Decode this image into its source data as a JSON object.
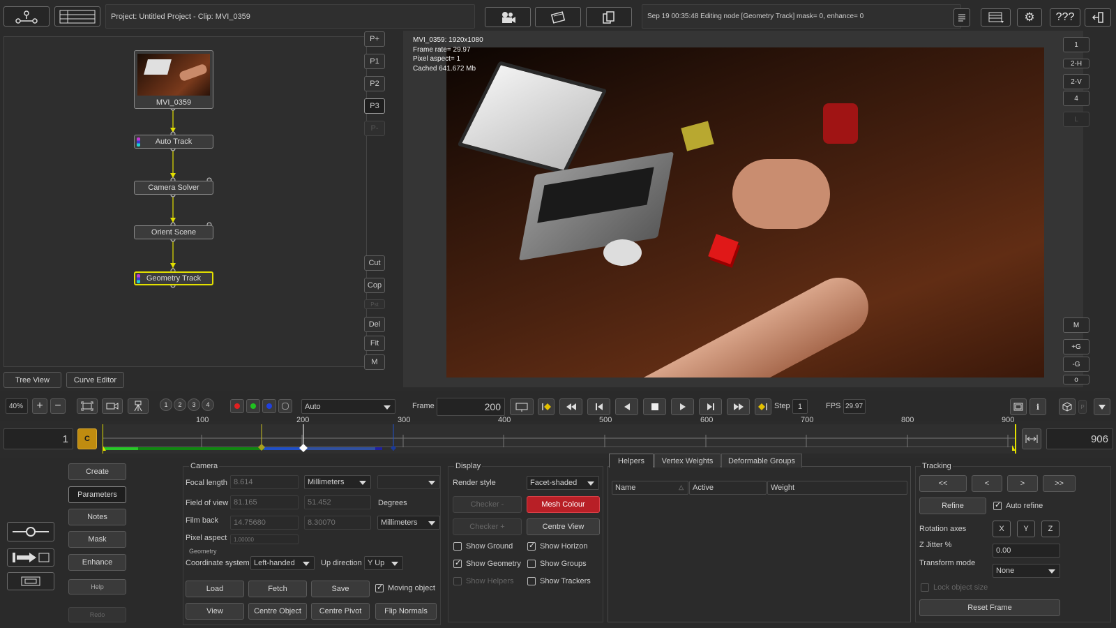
{
  "header": {
    "project_clip": "Project: Untitled Project - Clip: MVI_0359",
    "status": "Sep 19 00:35:48 Editing node [Geometry Track] mask= 0, enhance= 0",
    "help_label": "???"
  },
  "tree": {
    "nodes": {
      "source": "MVI_0359",
      "auto_track": "Auto Track",
      "camera_solver": "Camera Solver",
      "orient_scene": "Orient Scene",
      "geometry_track": "Geometry Track"
    },
    "tabs": {
      "tree_view": "Tree View",
      "curve_editor": "Curve Editor"
    }
  },
  "side_buttons": {
    "p_plus": "P+",
    "p1": "P1",
    "p2": "P2",
    "p3": "P3",
    "p_minus": "P-",
    "cut": "Cut",
    "cop": "Cop",
    "paste": "Pst",
    "del": "Del",
    "fit": "Fit",
    "m": "M"
  },
  "viewer": {
    "info_line1": "MVI_0359: 1920x1080",
    "info_line2": "Frame rate= 29.97",
    "info_line3": "Pixel aspect= 1",
    "info_line4": "Cached 641.672 Mb"
  },
  "right_buttons": {
    "b1": "1",
    "b2": "2-H",
    "b3": "2-V",
    "b4": "4",
    "b5": "L",
    "m": "M",
    "plus_g": "+G",
    "minus_g": "-G",
    "o": "o"
  },
  "transport": {
    "zoom": "40%",
    "view_nums": [
      "1",
      "2",
      "3",
      "4"
    ],
    "channel_mode": "Auto",
    "frame_label": "Frame",
    "frame_value": "200",
    "step_label": "Step",
    "step_value": "1",
    "fps_label": "FPS",
    "fps_value": "29.97"
  },
  "timeline": {
    "start": "1",
    "c_label": "C",
    "end": "906",
    "ticks": [
      "100",
      "200",
      "300",
      "400",
      "500",
      "600",
      "700",
      "800",
      "900"
    ]
  },
  "left_panel": {
    "create": "Create",
    "parameters": "Parameters",
    "notes": "Notes",
    "mask": "Mask",
    "enhance": "Enhance",
    "help": "Help",
    "redo": "Redo"
  },
  "camera": {
    "title": "Camera",
    "focal_length_label": "Focal length",
    "focal_length": "8.614",
    "focal_units": "Millimeters",
    "fov_label": "Field of view",
    "fov_h": "81.165",
    "fov_v": "51.452",
    "fov_units": "Degrees",
    "film_back_label": "Film back",
    "film_back_w": "14.75680",
    "film_back_h": "8.30070",
    "film_units": "Millimeters",
    "pixel_aspect_label": "Pixel aspect",
    "pixel_aspect": "1.00000",
    "geometry_label": "Geometry",
    "coord_label": "Coordinate system",
    "coord_value": "Left-handed",
    "up_label": "Up direction",
    "up_value": "Y Up",
    "load": "Load",
    "fetch": "Fetch",
    "save": "Save",
    "moving_object": "Moving object",
    "view": "View",
    "centre_object": "Centre Object",
    "centre_pivot": "Centre Pivot",
    "flip_normals": "Flip Normals"
  },
  "display": {
    "title": "Display",
    "render_style_label": "Render style",
    "render_style": "Facet-shaded",
    "checker_minus": "Checker -",
    "mesh_colour": "Mesh Colour",
    "checker_plus": "Checker +",
    "centre_view": "Centre View",
    "show_ground": "Show Ground",
    "show_horizon": "Show Horizon",
    "show_geometry": "Show Geometry",
    "show_groups": "Show Groups",
    "show_helpers": "Show Helpers",
    "show_trackers": "Show Trackers",
    "mesh_colour_hex": "#b81f26"
  },
  "helpers": {
    "tabs": [
      "Helpers",
      "Vertex Weights",
      "Deformable Groups"
    ],
    "columns": [
      "Name",
      "Active",
      "Weight"
    ]
  },
  "tracking": {
    "title": "Tracking",
    "nav": [
      "<<",
      "<",
      ">",
      ">>"
    ],
    "refine": "Refine",
    "auto_refine": "Auto refine",
    "rotation_axes_label": "Rotation axes",
    "axes": [
      "X",
      "Y",
      "Z"
    ],
    "z_jitter_label": "Z Jitter %",
    "z_jitter": "0.00",
    "transform_mode_label": "Transform mode",
    "transform_mode": "None",
    "lock_object_size": "Lock object size",
    "reset_frame": "Reset Frame"
  }
}
